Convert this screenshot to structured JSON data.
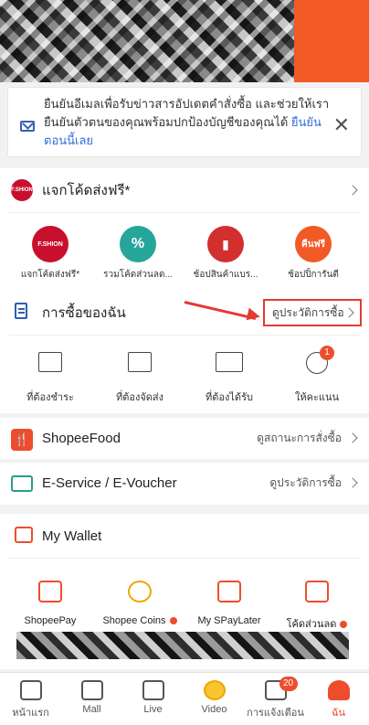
{
  "notice": {
    "text": "ยืนยันอีเมลเพื่อรับข่าวสารอัปเดตคำสั่งซื้อ และช่วยให้เรายืนยันตัวตนของคุณพร้อมปกป้องบัญชีของคุณได้ ",
    "link": "ยืนยันตอนนี้เลย",
    "close": "✕"
  },
  "fashion": {
    "title": "แจกโค้ดส่งฟรี*",
    "logo_text": "F.SHION",
    "tiles": [
      {
        "label": "แจกโค้ดส่งฟรี*",
        "icon": "fashion-logo-icon",
        "color": "#c8102e",
        "glyph": "F.SHION"
      },
      {
        "label": "รวมโค้ดส่วนลด...",
        "icon": "discount-ticket-icon",
        "color": "#26a69a",
        "glyph": "%"
      },
      {
        "label": "ช้อปสินค้าแบร...",
        "icon": "shopping-bag-icon",
        "color": "#d32f2f",
        "glyph": "▮"
      },
      {
        "label": "ช้อปปิ้การันตี",
        "icon": "refund-guarantee-icon",
        "color": "#f15a24",
        "glyph": "คืนฟรี"
      }
    ]
  },
  "orders": {
    "title": "การซื้อของฉัน",
    "history_link": "ดูประวัติการซื้อ",
    "statuses": [
      {
        "label": "ที่ต้องชำระ",
        "icon": "wallet-pay-icon"
      },
      {
        "label": "ที่ต้องจัดส่ง",
        "icon": "box-icon"
      },
      {
        "label": "ที่ต้องได้รับ",
        "icon": "truck-icon"
      },
      {
        "label": "ให้คะแนน",
        "icon": "star-rating-icon",
        "badge": "1"
      }
    ]
  },
  "food": {
    "title": "ShopeeFood",
    "link": "ดูสถานะการสั่งซื้อ"
  },
  "eservice": {
    "title": "E-Service / E-Voucher",
    "link": "ดูประวัติการซื้อ"
  },
  "wallet": {
    "title": "My Wallet",
    "items": [
      {
        "label": "ShopeePay",
        "icon": "shopeepay-icon",
        "dot": false
      },
      {
        "label": "Shopee Coins",
        "icon": "coin-icon",
        "dot": true
      },
      {
        "label": "My SPayLater",
        "icon": "spaylater-icon",
        "dot": false
      },
      {
        "label": "โค้ดส่วนลด",
        "icon": "voucher-icon",
        "dot": true
      }
    ]
  },
  "nav": {
    "items": [
      {
        "label": "หน้าแรก",
        "icon": "home-icon"
      },
      {
        "label": "Mall",
        "icon": "mall-bag-icon"
      },
      {
        "label": "Live",
        "icon": "live-video-icon"
      },
      {
        "label": "Video",
        "icon": "video-coin-icon"
      },
      {
        "label": "การแจ้งเตือน",
        "icon": "bell-icon",
        "badge": "20"
      },
      {
        "label": "ฉัน",
        "icon": "profile-icon",
        "active": true
      }
    ]
  },
  "colors": {
    "accent": "#ee4d2d",
    "link_blue": "#2f6fd6",
    "highlight_red": "#e53935"
  }
}
